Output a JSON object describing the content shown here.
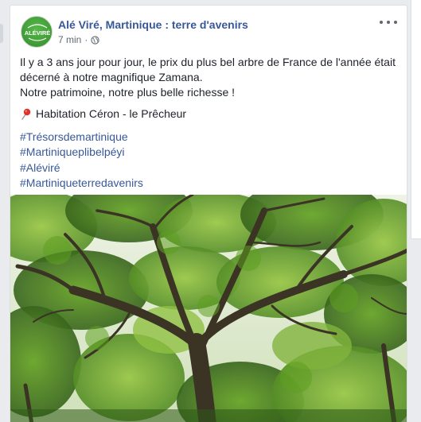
{
  "post": {
    "page_name": "Alé Viré, Martinique : terre d'avenirs",
    "avatar_text": "ALÉVIRÉ",
    "timestamp": "7 min",
    "audience_icon": "globe-icon",
    "more_icon": "more-options-icon",
    "text_lines": [
      "Il y a 3 ans jour pour jour, le prix du plus bel arbre de France de l'année était",
      "décerné à notre magnifique Zamana.",
      "Notre patrimoine, notre plus belle richesse !"
    ],
    "location_icon": "pushpin-icon",
    "location": "Habitation Céron - le Prêcheur",
    "hashtags": [
      "#Trésorsdemartinique",
      "#Martiniqueplibelpéyi",
      "#Aléviré",
      "#Martiniqueterredavenirs"
    ],
    "photo_subject": "Zamana tree canopy"
  },
  "colors": {
    "link": "#385898",
    "text": "#1d2129",
    "meta": "#616770",
    "background": "#e9ebee",
    "avatar_green": "#3f9a36"
  }
}
